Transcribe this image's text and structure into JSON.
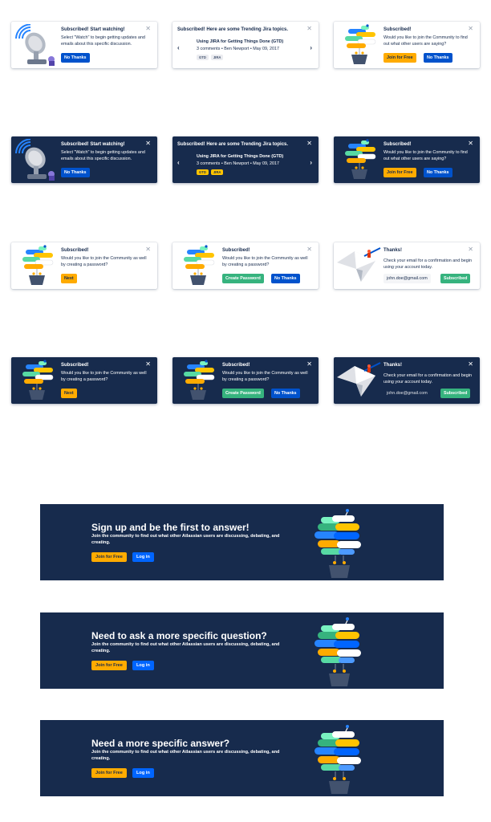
{
  "colors": {
    "navy": "#172b4d",
    "blue": "#0052cc",
    "yellow": "#ffab00",
    "green": "#36b37e"
  },
  "close_glyph": "✕",
  "arrows": {
    "prev": "‹",
    "next": "›"
  },
  "watch": {
    "title": "Subscribed! Start watching!",
    "body": "Select \"Watch\" to begin getting updates and emails about this specific discussion.",
    "button": "No Thanks"
  },
  "trending": {
    "title": "Subscribed! Here are some Trending Jira topics.",
    "light_item_title": "Using JIRA for Getting Things Done (GTD)",
    "light_item_meta": "3 comments • Ben Newport • May 09, 2017",
    "dark_item_title": "Using JIRA for Getting Things Done (GTD)",
    "dark_item_meta": "3 comments • Ben Newport • May 09, 2017",
    "tags": [
      "GTD",
      "JIRA"
    ]
  },
  "join": {
    "title": "Subscribed!",
    "body": "Would you like to join the Community to find out what other users are saying?",
    "join_button": "Join for Free",
    "no_button": "No Thanks"
  },
  "password": {
    "title": "Subscribed!",
    "body": "Would you like to join the Community as well by creating a password?",
    "next_button": "Next",
    "create_button": "Create Password",
    "no_button": "No Thanks"
  },
  "thanks": {
    "title": "Thanks!",
    "body": "Check your email for a confirmation and begin using your account today.",
    "email": "john.doe@gmail.com",
    "button": "Subscribed"
  },
  "banners": [
    {
      "headline": "Sign up and be the first to answer!",
      "sub": "Join the community to find out what other Atlassian users are discussing, debating, and creating.",
      "join": "Join for Free",
      "login": "Log in"
    },
    {
      "headline": "Need to ask a more specific question?",
      "sub": "Join the community to find out what other Atlassian users are discussing, debating, and creating.",
      "join": "Join for Free",
      "login": "Log in"
    },
    {
      "headline": "Need a more specific answer?",
      "sub": "Join the community to find out what other Atlassian users are discussing, debating, and creating.",
      "join": "Join for Free",
      "login": "Log in"
    }
  ]
}
